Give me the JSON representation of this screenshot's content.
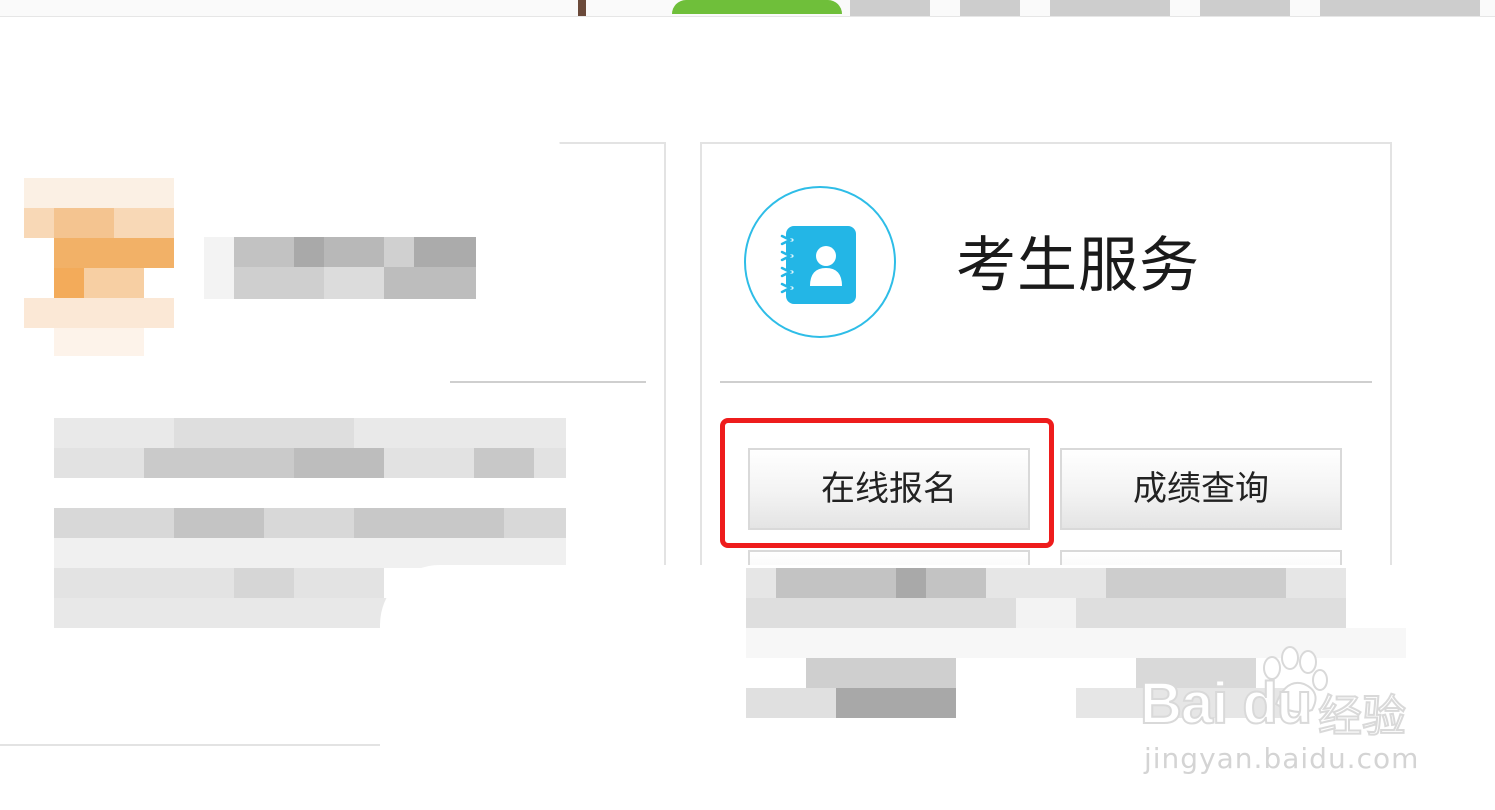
{
  "student_service": {
    "title": "考生服务",
    "icon": "contact-book-icon",
    "buttons": [
      {
        "label": "在线报名",
        "highlighted": true
      },
      {
        "label": "成绩查询",
        "highlighted": false
      }
    ]
  },
  "watermark": {
    "brand": "Bai du",
    "suffix": "经验",
    "url": "jingyan.baidu.com"
  },
  "colors": {
    "accent": "#2ebde7",
    "highlight_box": "#ee1c1c"
  }
}
